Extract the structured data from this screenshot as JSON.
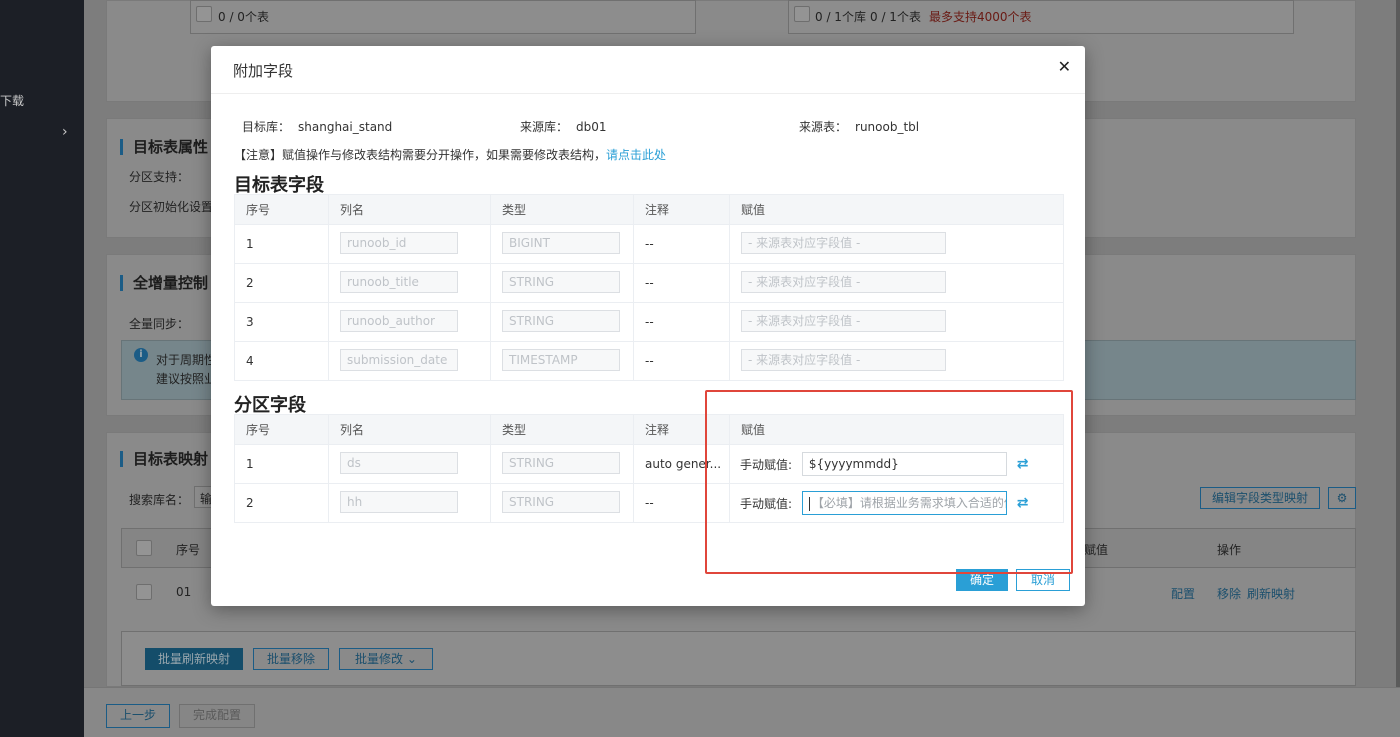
{
  "sidebar": {
    "download_label": "下载",
    "expand_icon": "chevron-right-icon"
  },
  "background": {
    "top_left_count": "0 / 0个表",
    "top_right_count1": "0 / 1个库",
    "top_right_count2": "0 / 1个表",
    "top_right_limit": "最多支持4000个表",
    "sec_table_props": "目标表属性",
    "partition_support": "分区支持：",
    "partition_init": "分区初始化设置",
    "sec_increment": "全增量控制",
    "full_sync": "全量同步：",
    "info_line1": "对于周期性",
    "info_line2": "建议按照业",
    "sec_mapping": "目标表映射",
    "search_db_label": "搜索库名：",
    "search_db_placeholder": "输",
    "edit_type_mapping": "编辑字段类型映射",
    "col_seq": "序号",
    "col_assign": "赋值",
    "col_op": "操作",
    "row_seq": "01",
    "row_config": "配置",
    "row_remove": "移除",
    "row_refresh": "刷新映射",
    "batch_refresh": "批量刷新映射",
    "batch_remove": "批量移除",
    "batch_modify": "批量修改",
    "prev_step": "上一步",
    "finish_config": "完成配置"
  },
  "modal": {
    "title": "附加字段",
    "target_db_label": "目标库：",
    "target_db": "shanghai_stand",
    "source_db_label": "来源库：",
    "source_db": "db01",
    "source_table_label": "来源表：",
    "source_table": "runoob_tbl",
    "notice": "【注意】赋值操作与修改表结构需要分开操作，如果需要修改表结构，",
    "notice_link": "请点击此处",
    "target_fields_title": "目标表字段",
    "partition_fields_title": "分区字段",
    "columns": [
      "序号",
      "列名",
      "类型",
      "注释",
      "赋值"
    ],
    "target_rows": [
      {
        "seq": "1",
        "name": "runoob_id",
        "type": "BIGINT",
        "comment": "--",
        "assign_placeholder": "- 来源表对应字段值 -"
      },
      {
        "seq": "2",
        "name": "runoob_title",
        "type": "STRING",
        "comment": "--",
        "assign_placeholder": "- 来源表对应字段值 -"
      },
      {
        "seq": "3",
        "name": "runoob_author",
        "type": "STRING",
        "comment": "--",
        "assign_placeholder": "- 来源表对应字段值 -"
      },
      {
        "seq": "4",
        "name": "submission_date",
        "type": "TIMESTAMP",
        "comment": "--",
        "assign_placeholder": "- 来源表对应字段值 -"
      }
    ],
    "partition_rows": [
      {
        "seq": "1",
        "name": "ds",
        "type": "STRING",
        "comment": "auto gener...",
        "manual_label": "手动赋值:",
        "value": "${yyyymmdd}",
        "placeholder": ""
      },
      {
        "seq": "2",
        "name": "hh",
        "type": "STRING",
        "comment": "--",
        "manual_label": "手动赋值:",
        "value": "",
        "placeholder": "【必填】请根据业务需求填入合适的值"
      }
    ],
    "confirm": "确定",
    "cancel": "取消"
  },
  "colors": {
    "accent": "#2a9fd6",
    "highlight": "#e0463b",
    "primary_dark": "#1b5c86"
  }
}
